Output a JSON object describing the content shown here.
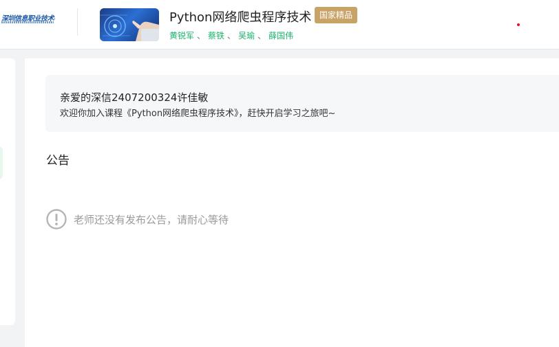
{
  "header": {
    "school_name": "深圳信息职业技术学院",
    "course_title": "Python网络爬虫程序技术",
    "badge": "国家精品",
    "teachers": [
      "黄锐军",
      "蔡铁",
      "吴瑜",
      "薛国伟"
    ],
    "teacher_separator": "、"
  },
  "welcome": {
    "title": "亲爱的深信2407200324许佳敏",
    "text": "欢迎你加入课程《Python网络爬虫程序技术》，赶快开启学习之旅吧~"
  },
  "announcements": {
    "section_title": "公告",
    "empty_text": "老师还没有发布公告，请耐心等待"
  },
  "icons": {
    "empty_state": "exclamation-circle-icon",
    "notification": "red-dot-indicator"
  },
  "colors": {
    "badge_bg": "#c9a266",
    "teacher_link": "#18b56b",
    "notification_dot": "#e3141c",
    "muted_text": "#9a9a9a"
  }
}
